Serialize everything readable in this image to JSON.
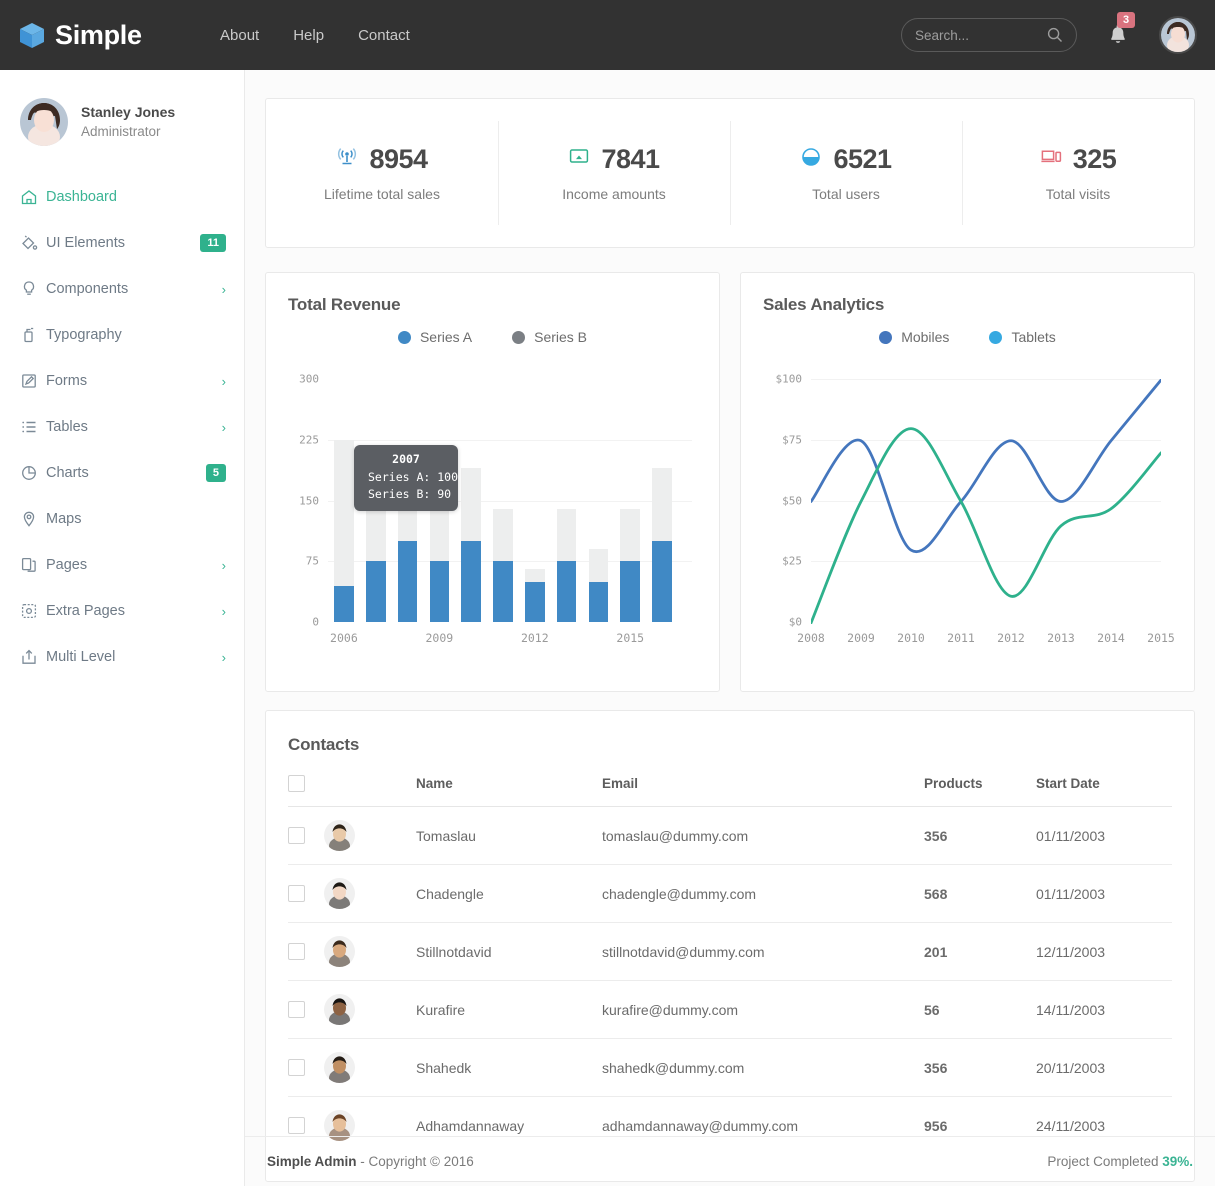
{
  "topbar": {
    "brand": "Simple",
    "brand_icon": "cube-icon",
    "nav": [
      {
        "label": "About",
        "name": "about"
      },
      {
        "label": "Help",
        "name": "help"
      },
      {
        "label": "Contact",
        "name": "contact"
      }
    ],
    "search": {
      "placeholder": "Search...",
      "value": "",
      "icon": "search-icon"
    },
    "notifications": {
      "count": "3",
      "icon": "bell-icon"
    },
    "avatar": "user-avatar"
  },
  "sidebar": {
    "profile": {
      "name": "Stanley Jones",
      "role": "Administrator"
    },
    "items": [
      {
        "label": "Dashboard",
        "icon": "home-icon",
        "active": true,
        "badge": null,
        "chevron": false
      },
      {
        "label": "UI Elements",
        "icon": "paint-icon",
        "active": false,
        "badge": "11",
        "chevron": false
      },
      {
        "label": "Components",
        "icon": "bulb-icon",
        "active": false,
        "badge": null,
        "chevron": true
      },
      {
        "label": "Typography",
        "icon": "type-icon",
        "active": false,
        "badge": null,
        "chevron": false
      },
      {
        "label": "Forms",
        "icon": "pencil-icon",
        "active": false,
        "badge": null,
        "chevron": true
      },
      {
        "label": "Tables",
        "icon": "list-icon",
        "active": false,
        "badge": null,
        "chevron": true
      },
      {
        "label": "Charts",
        "icon": "piechart-icon",
        "active": false,
        "badge": "5",
        "chevron": false
      },
      {
        "label": "Maps",
        "icon": "mappin-icon",
        "active": false,
        "badge": null,
        "chevron": false
      },
      {
        "label": "Pages",
        "icon": "copy-icon",
        "active": false,
        "badge": null,
        "chevron": true
      },
      {
        "label": "Extra Pages",
        "icon": "gear-icon",
        "active": false,
        "badge": null,
        "chevron": true
      },
      {
        "label": "Multi Level",
        "icon": "share-icon",
        "active": false,
        "badge": null,
        "chevron": true
      }
    ]
  },
  "stats": [
    {
      "value": "8954",
      "label": "Lifetime total sales",
      "icon": "broadcast-icon",
      "color": "#3d8fc9"
    },
    {
      "value": "7841",
      "label": "Income amounts",
      "icon": "monitor-icon",
      "color": "#2fb18c"
    },
    {
      "value": "6521",
      "label": "Total users",
      "icon": "piechart-icon",
      "color": "#36a9e1"
    },
    {
      "value": "325",
      "label": "Total visits",
      "icon": "devices-icon",
      "color": "#e4707c"
    }
  ],
  "chart_data": [
    {
      "type": "bar",
      "title": "Total Revenue",
      "stacked": true,
      "xlabel": "",
      "ylabel": "",
      "ylim": [
        0,
        300
      ],
      "yticks": [
        0,
        75,
        150,
        225,
        300
      ],
      "grid": true,
      "legend_position": "top",
      "categories": [
        "2006",
        "2007",
        "2008",
        "2009",
        "2010",
        "2011",
        "2012",
        "2013",
        "2014",
        "2015"
      ],
      "xtick_labels": [
        "2006",
        "2009",
        "2012",
        "2015"
      ],
      "series": [
        {
          "name": "Series A",
          "color": "#4089c5",
          "values": [
            45,
            75,
            100,
            75,
            100,
            75,
            50,
            75,
            50,
            75,
            100
          ]
        },
        {
          "name": "Series B",
          "color": "#7b7f84",
          "values": [
            180,
            90,
            90,
            115,
            90,
            65,
            15,
            65,
            40,
            65,
            90
          ]
        }
      ],
      "totals": [
        "225",
        "165",
        "190",
        "190",
        "190",
        "140",
        "95",
        "140",
        "90",
        "140",
        "190"
      ],
      "tooltip": {
        "title": "2007",
        "rows": [
          "Series A: 100",
          "Series B: 90"
        ]
      }
    },
    {
      "type": "line",
      "title": "Sales Analytics",
      "xlabel": "",
      "ylabel": "",
      "ylim": [
        0,
        100
      ],
      "yticks": [
        "$0",
        "$25",
        "$50",
        "$75",
        "$100"
      ],
      "grid": true,
      "legend_position": "top",
      "x": [
        "2008",
        "2009",
        "2010",
        "2011",
        "2012",
        "2013",
        "2014",
        "2015"
      ],
      "series": [
        {
          "name": "Mobiles",
          "color": "#4476bd",
          "values": [
            50,
            75,
            30,
            50,
            75,
            50,
            75,
            100
          ]
        },
        {
          "name": "Tablets",
          "color": "#2eb18c",
          "values": [
            0,
            50,
            80,
            50,
            11,
            40,
            47,
            70
          ]
        }
      ]
    }
  ],
  "contacts": {
    "title": "Contacts",
    "columns": [
      "",
      "",
      "Name",
      "Email",
      "Products",
      "Start Date"
    ],
    "rows": [
      {
        "name": "Tomaslau",
        "email": "tomaslau@dummy.com",
        "products": "356",
        "date": "01/11/2003"
      },
      {
        "name": "Chadengle",
        "email": "chadengle@dummy.com",
        "products": "568",
        "date": "01/11/2003"
      },
      {
        "name": "Stillnotdavid",
        "email": "stillnotdavid@dummy.com",
        "products": "201",
        "date": "12/11/2003"
      },
      {
        "name": "Kurafire",
        "email": "kurafire@dummy.com",
        "products": "56",
        "date": "14/11/2003"
      },
      {
        "name": "Shahedk",
        "email": "shahedk@dummy.com",
        "products": "356",
        "date": "20/11/2003"
      },
      {
        "name": "Adhamdannaway",
        "email": "adhamdannaway@dummy.com",
        "products": "956",
        "date": "24/11/2003"
      }
    ]
  },
  "footer": {
    "brand": "Simple Admin",
    "copyright": " - Copyright © 2016",
    "progress_label": "Project Completed ",
    "progress_value": "39%."
  }
}
